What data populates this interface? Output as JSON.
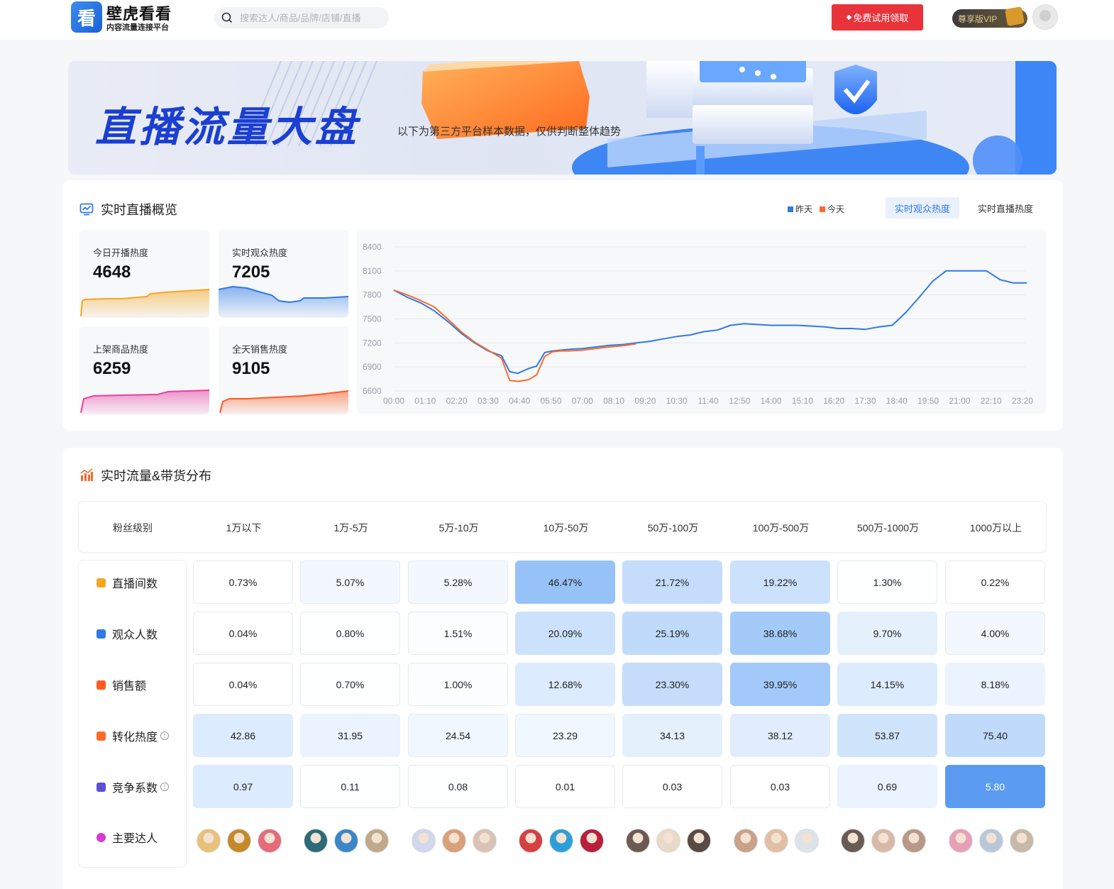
{
  "header": {
    "logo_char": "看",
    "title": "壁虎看看",
    "subtitle": "内容流量连接平台",
    "search_placeholder": "搜索达人/商品/品牌/店铺/直播",
    "trial_button": "免费试用领取",
    "vip_label": "尊享版VIP"
  },
  "banner": {
    "title": "直播流量大盘",
    "subtitle": "以下为第三方平台样本数据，仅供判断整体趋势"
  },
  "overview": {
    "title": "实时直播概览",
    "legend": [
      {
        "label": "昨天",
        "color": "#2f7ae5"
      },
      {
        "label": "今天",
        "color": "#ff6a2b"
      }
    ],
    "tabs": [
      {
        "label": "实时观众热度",
        "active": true
      },
      {
        "label": "实时直播热度",
        "active": false
      }
    ],
    "stats": [
      {
        "label": "今日开播热度",
        "value": "4648",
        "color": "#f5a623"
      },
      {
        "label": "实时观众热度",
        "value": "7205",
        "color": "#2f7ae5"
      },
      {
        "label": "上架商品热度",
        "value": "6259",
        "color": "#e93fa3"
      },
      {
        "label": "全天销售热度",
        "value": "9105",
        "color": "#ff5a1f"
      }
    ]
  },
  "chart_data": {
    "type": "line",
    "title": "",
    "xlabel": "",
    "ylabel": "",
    "ylim": [
      6600,
      8400
    ],
    "yticks": [
      6600,
      6900,
      7200,
      7500,
      7800,
      8100,
      8400
    ],
    "xticks": [
      "00:00",
      "01:10",
      "02:20",
      "03:30",
      "04:40",
      "05:50",
      "07:00",
      "08:10",
      "09:20",
      "10:30",
      "11:40",
      "12:50",
      "14:00",
      "15:10",
      "16:20",
      "17:30",
      "18:40",
      "19:50",
      "21:00",
      "22:10",
      "23:20"
    ],
    "x_hours": [
      0,
      0.5,
      1,
      1.5,
      2,
      2.5,
      3,
      3.5,
      4,
      4.3,
      4.6,
      5,
      5.3,
      5.6,
      5.9,
      6.2,
      6.5,
      7,
      7.5,
      8,
      8.5,
      9,
      9.5,
      10,
      10.5,
      11,
      11.5,
      12,
      12.5,
      13,
      13.5,
      14,
      14.5,
      15,
      15.5,
      16,
      16.5,
      17,
      17.5,
      18,
      18.5,
      19,
      19.5,
      20,
      20.5,
      21,
      21.5,
      22,
      22.5,
      23,
      23.5
    ],
    "series": [
      {
        "name": "昨天",
        "color": "#2f7ae5",
        "values": [
          7860,
          7770,
          7700,
          7600,
          7470,
          7320,
          7200,
          7100,
          7040,
          6840,
          6820,
          6880,
          6910,
          7080,
          7100,
          7110,
          7120,
          7130,
          7150,
          7170,
          7180,
          7200,
          7220,
          7250,
          7280,
          7300,
          7340,
          7360,
          7420,
          7440,
          7430,
          7420,
          7420,
          7420,
          7410,
          7400,
          7380,
          7380,
          7370,
          7400,
          7420,
          7580,
          7770,
          7970,
          8100,
          8100,
          8100,
          8100,
          7990,
          7950,
          7950
        ]
      },
      {
        "name": "今天",
        "color": "#ff6a2b",
        "values": [
          7860,
          7800,
          7730,
          7650,
          7500,
          7340,
          7210,
          7110,
          7010,
          6730,
          6720,
          6740,
          6800,
          7030,
          7090,
          7100,
          7100,
          7110,
          7130,
          7150,
          7165,
          7190
        ]
      }
    ]
  },
  "distribution": {
    "title": "实时流量&带货分布",
    "corner": "粉丝级别",
    "columns": [
      "1万以下",
      "1万-5万",
      "5万-10万",
      "10万-50万",
      "50万-100万",
      "100万-500万",
      "500万-1000万",
      "1000万以上"
    ],
    "rows": [
      {
        "label": "直播间数",
        "icon_color": "#f5a623",
        "info": false,
        "cells": [
          "0.73%",
          "5.07%",
          "5.28%",
          "46.47%",
          "21.72%",
          "19.22%",
          "1.30%",
          "0.22%"
        ],
        "levels": [
          0.0,
          0.1,
          0.1,
          0.9,
          0.5,
          0.45,
          0.02,
          0.0
        ]
      },
      {
        "label": "观众人数",
        "icon_color": "#2f7ae5",
        "info": false,
        "cells": [
          "0.04%",
          "0.80%",
          "1.51%",
          "20.09%",
          "25.19%",
          "38.68%",
          "9.70%",
          "4.00%"
        ],
        "levels": [
          0.0,
          0.02,
          0.03,
          0.45,
          0.55,
          0.78,
          0.22,
          0.1
        ]
      },
      {
        "label": "销售额",
        "icon_color": "#ff5a1f",
        "info": false,
        "cells": [
          "0.04%",
          "0.70%",
          "1.00%",
          "12.68%",
          "23.30%",
          "39.95%",
          "14.15%",
          "8.18%"
        ],
        "levels": [
          0.0,
          0.02,
          0.03,
          0.3,
          0.5,
          0.8,
          0.3,
          0.18
        ]
      },
      {
        "label": "转化热度",
        "icon_color": "#ff6a2b",
        "info": true,
        "cells": [
          "42.86",
          "31.95",
          "24.54",
          "23.29",
          "34.13",
          "38.12",
          "53.87",
          "75.40"
        ],
        "levels": [
          0.3,
          0.18,
          0.12,
          0.12,
          0.22,
          0.26,
          0.4,
          0.55
        ]
      },
      {
        "label": "竞争系数",
        "icon_color": "#5b4fd6",
        "info": true,
        "cells": [
          "0.97",
          "0.11",
          "0.08",
          "0.01",
          "0.03",
          "0.03",
          "0.69",
          "5.80"
        ],
        "levels": [
          0.3,
          0.02,
          0.02,
          0.0,
          0.0,
          0.0,
          0.18,
          1.0
        ]
      }
    ],
    "creators_label": "主要达人",
    "creators_icon_color": "#d63ad6",
    "avatar_colors": [
      [
        "#e8c27a",
        "#c48a2a",
        "#e46b78"
      ],
      [
        "#2e6b78",
        "#3a86c9",
        "#bfa98a"
      ],
      [
        "#cfd8ec",
        "#d9a07a",
        "#d8c3b5"
      ],
      [
        "#d64040",
        "#2d9fd8",
        "#b8203a"
      ],
      [
        "#6c5a52",
        "#e8d9c8",
        "#5a4a44"
      ],
      [
        "#c9a28a",
        "#e0bfa5",
        "#dde3ea"
      ],
      [
        "#6a5a55",
        "#d8b8a8",
        "#b89888"
      ],
      [
        "#e5a0b8",
        "#b8c8d8",
        "#c8b8a8"
      ]
    ]
  }
}
